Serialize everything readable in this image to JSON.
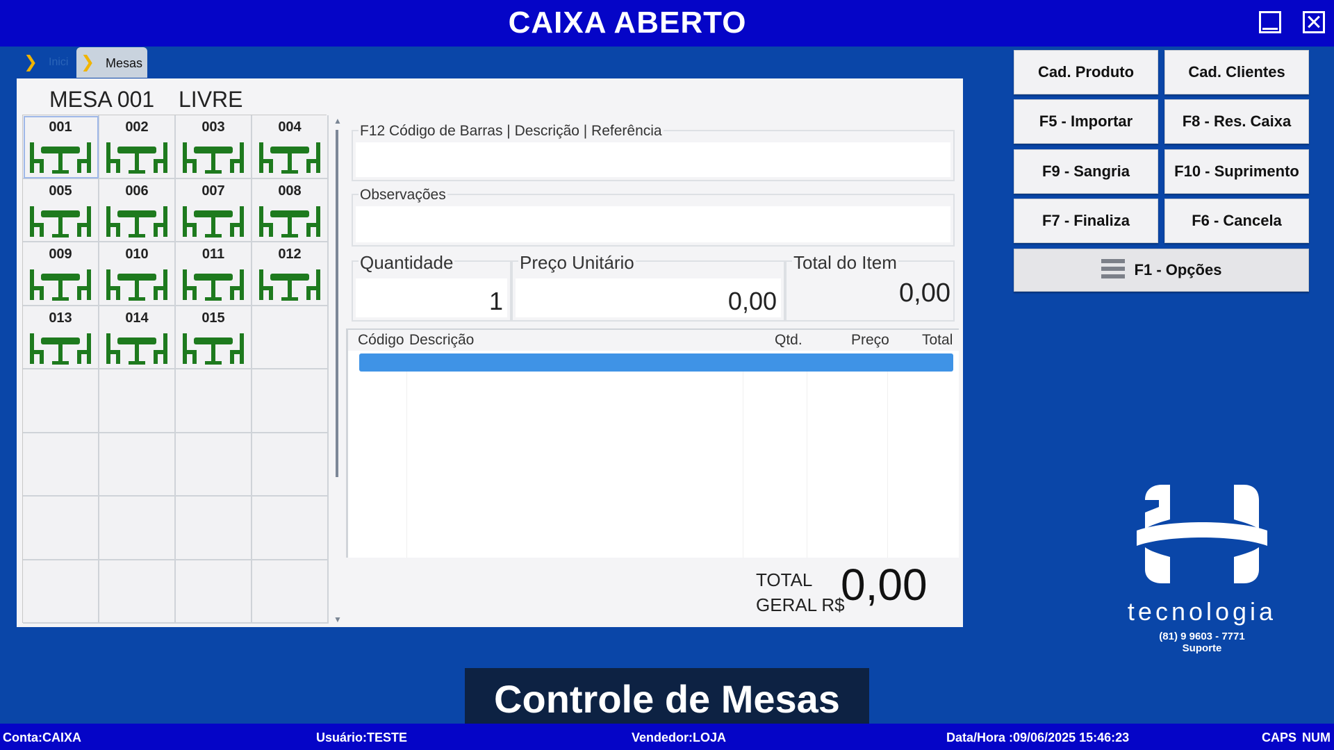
{
  "window": {
    "title": "CAIXA ABERTO"
  },
  "breadcrumb": {
    "home": "Inici",
    "current": "Mesas"
  },
  "mesa": {
    "title": "MESA 001",
    "status": "LIVRE"
  },
  "tables": [
    "001",
    "002",
    "003",
    "004",
    "005",
    "006",
    "007",
    "008",
    "009",
    "010",
    "011",
    "012",
    "013",
    "014",
    "015"
  ],
  "fields": {
    "code_label": "F12 Código de Barras | Descrição | Referência",
    "code_value": "",
    "obs_label": "Observações",
    "obs_value": "",
    "qty_label": "Quantidade",
    "qty_value": "1",
    "price_label": "Preço Unitário",
    "price_value": "0,00",
    "item_total_label": "Total do Item",
    "item_total_value": "0,00"
  },
  "items_table": {
    "headers": {
      "code": "Código",
      "desc": "Descrição",
      "qty": "Qtd.",
      "price": "Preço",
      "total": "Total"
    }
  },
  "total": {
    "label_line1": "TOTAL",
    "label_line2": "GERAL R$",
    "value": "0,00"
  },
  "buttons": {
    "cad_produto": "Cad. Produto",
    "cad_clientes": "Cad. Clientes",
    "importar": "F5 - Importar",
    "res_caixa": "F8 - Res. Caixa",
    "sangria": "F9 - Sangria",
    "suprimento": "F10 - Suprimento",
    "finaliza": "F7 - Finaliza",
    "cancela": "F6 - Cancela",
    "opcoes": "F1 - Opções"
  },
  "logo": {
    "word": "tecnologia",
    "phone": "(81) 9 9603 - 7771",
    "support": "Suporte"
  },
  "caption": "Controle de Mesas",
  "status": {
    "conta": "Conta:CAIXA",
    "usuario": "Usuário:TESTE",
    "vendedor": "Vendedor:LOJA",
    "datahora": "Data/Hora :09/06/2025 15:46:23",
    "caps": "CAPS",
    "num": "NUM"
  },
  "colors": {
    "background": "#0a46a8",
    "titlebar": "#0505c7",
    "table_icon": "#1e7a1e",
    "selected_row": "#3f93e6"
  }
}
